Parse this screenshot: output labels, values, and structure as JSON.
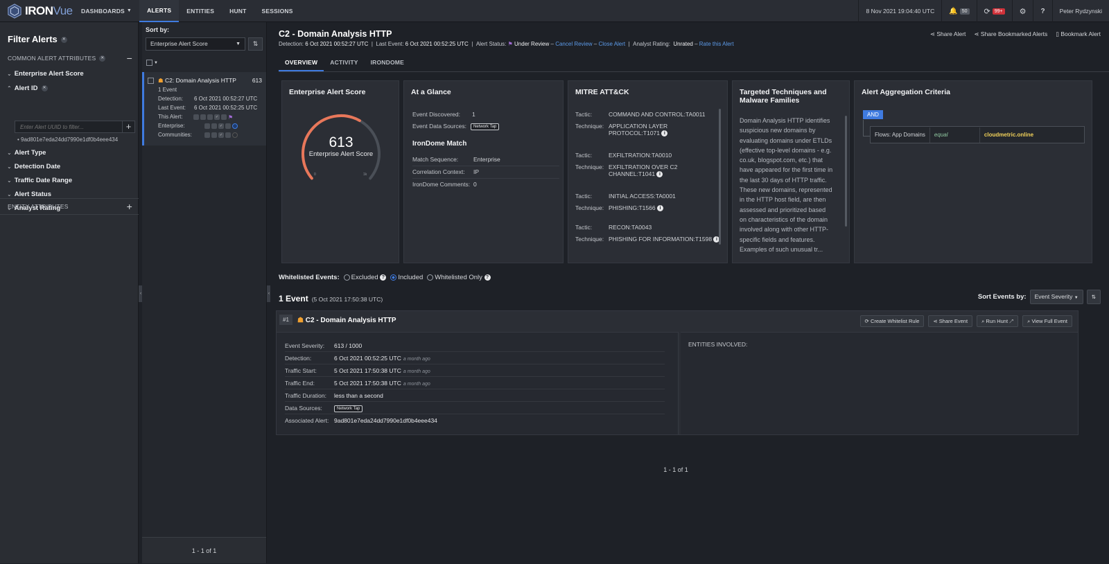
{
  "topbar": {
    "logo_iron": "IRON",
    "logo_vue": "Vue",
    "nav": [
      {
        "label": "DASHBOARDS",
        "has_caret": true
      },
      {
        "label": "ALERTS",
        "active": true
      },
      {
        "label": "ENTITIES"
      },
      {
        "label": "HUNT"
      },
      {
        "label": "SESSIONS"
      }
    ],
    "datetime": "8 Nov 2021 19:04:40 UTC",
    "alerts_count": "50",
    "sync_count": "99+",
    "user": "Peter Rydzynski"
  },
  "filter": {
    "title": "Filter Alerts",
    "common_header": "COMMON ALERT ATTRIBUTES",
    "items": [
      "Enterprise Alert Score",
      "Alert ID",
      "Alert Type",
      "Detection Date",
      "Traffic Date Range",
      "Alert Status",
      "Analyst Rating"
    ],
    "uuid_placeholder": "Enter Alert UUID to filter...",
    "uuid_value": "9ad801e7eda24dd7990e1df0b4eee434",
    "entity_header": "ENTITY ATTRIBUTES"
  },
  "list": {
    "sort_label": "Sort by:",
    "sort_value": "Enterprise Alert Score",
    "card": {
      "title": "C2: Domain Analysis HTTP",
      "score": "613",
      "events": "1 Event",
      "detection_label": "Detection:",
      "detection": "6 Oct 2021 00:52:27 UTC",
      "last_label": "Last Event:",
      "last": "6 Oct 2021 00:52:25 UTC",
      "this_alert": "This Alert:",
      "enterprise": "Enterprise:",
      "communities": "Communities:"
    },
    "footer": "1 - 1 of 1"
  },
  "main": {
    "title": "C2 - Domain Analysis HTTP",
    "detection_label": "Detection:",
    "detection": "6 Oct 2021 00:52:27 UTC",
    "last_event_label": "Last Event:",
    "last_event": "6 Oct 2021 00:52:25 UTC",
    "status_label": "Alert Status:",
    "status": "Under Review",
    "cancel_review": "Cancel Review",
    "close_alert": "Close Alert",
    "rating_label": "Analyst Rating:",
    "rating": "Unrated",
    "rate_link": "Rate this Alert",
    "actions": [
      "Share Alert",
      "Share Bookmarked Alerts",
      "Bookmark Alert"
    ],
    "tabs": [
      "OVERVIEW",
      "ACTIVITY",
      "IRONDOME"
    ],
    "score_panel": {
      "title": "Enterprise Alert Score",
      "score": "613",
      "score_value": 613,
      "score_max": 1000,
      "label": "Enterprise Alert Score",
      "min": "0",
      "max": "1k"
    },
    "glance": {
      "title": "At a Glance",
      "rows": [
        {
          "k": "Event Discovered:",
          "v": "1"
        },
        {
          "k": "Event Data Sources:",
          "v": "Network Tap"
        }
      ],
      "irondome_title": "IronDome Match",
      "irondome_rows": [
        {
          "k": "Match Sequence:",
          "v": "Enterprise"
        },
        {
          "k": "Correlation Context:",
          "v": "IP"
        },
        {
          "k": "IronDome Comments:",
          "v": "0"
        }
      ]
    },
    "mitre": {
      "title": "MITRE ATT&CK",
      "tactic_label": "Tactic:",
      "technique_label": "Technique:",
      "entries": [
        {
          "tactic": "COMMAND AND CONTROL:TA0011",
          "technique": "APPLICATION LAYER PROTOCOL:T1071"
        },
        {
          "tactic": "EXFILTRATION:TA0010",
          "technique": "EXFILTRATION OVER C2 CHANNEL:T1041"
        },
        {
          "tactic": "INITIAL ACCESS:TA0001",
          "technique": "PHISHING:T1566"
        },
        {
          "tactic": "RECON:TA0043",
          "technique": "PHISHING FOR INFORMATION:T1598"
        }
      ]
    },
    "techniques": {
      "title": "Targeted Techniques and Malware Families",
      "body": "Domain Analysis HTTP identifies suspicious new domains by evaluating domains under ETLDs (effective top-level domains - e.g. co.uk, blogspot.com, etc.) that have appeared for the first time in the last 30 days of HTTP traffic. These new domains, represented in the HTTP host field, are then assessed and prioritized based on characteristics of the domain involved along with other HTTP-specific fields and features. Examples of such unusual tr..."
    },
    "aggregation": {
      "title": "Alert Aggregation Criteria",
      "op": "AND",
      "field": "Flows: App Domains",
      "cmp": "equal",
      "value": "cloudmetric.online"
    },
    "whitelist": {
      "label": "Whitelisted Events:",
      "options": [
        "Excluded",
        "Included",
        "Whitelisted Only"
      ],
      "selected": "Included"
    },
    "events_header": "1 Event",
    "events_time": "(5 Oct 2021 17:50:38 UTC)",
    "sort_events_label": "Sort Events by:",
    "sort_events_value": "Event Severity",
    "event": {
      "num": "#1",
      "title": "C2 - Domain Analysis HTTP",
      "buttons": [
        "Create Whitelist Rule",
        "Share Event",
        "Run Hunt",
        "View Full Event"
      ],
      "rows": [
        {
          "k": "Event Severity:",
          "v": "613 / 1000",
          "ago": ""
        },
        {
          "k": "Detection:",
          "v": "6 Oct 2021 00:52:25 UTC",
          "ago": "a month ago"
        },
        {
          "k": "Traffic Start:",
          "v": "5 Oct 2021 17:50:38 UTC",
          "ago": "a month ago"
        },
        {
          "k": "Traffic End:",
          "v": "5 Oct 2021 17:50:38 UTC",
          "ago": "a month ago"
        },
        {
          "k": "Traffic Duration:",
          "v": "less than a second",
          "ago": ""
        },
        {
          "k": "Data Sources:",
          "v": "Network Tap",
          "ago": ""
        },
        {
          "k": "Associated Alert:",
          "v": "9ad801e7eda24dd7990e1df0b4eee434",
          "ago": ""
        }
      ],
      "entities_label": "ENTITIES INVOLVED:"
    },
    "pager": "1 - 1 of 1"
  },
  "colors": {
    "accent": "#3f7be0",
    "score_arc": "#e8775a",
    "flag": "#a06bd3",
    "red_badge": "#d0323a",
    "link": "#5c9ae8",
    "highlight": "#f2d25a"
  }
}
